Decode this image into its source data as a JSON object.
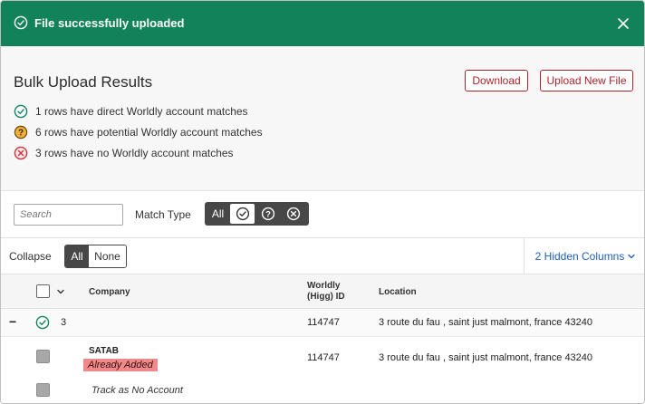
{
  "banner": {
    "message": "File successfully uploaded"
  },
  "results": {
    "title": "Bulk Upload Results",
    "download_label": "Download",
    "upload_label": "Upload New File",
    "summary": [
      {
        "text": "1 rows have direct Worldly account matches",
        "status": "direct"
      },
      {
        "text": "6 rows have potential Worldly account matches",
        "status": "potential"
      },
      {
        "text": "3 rows have no Worldly account matches",
        "status": "none"
      }
    ]
  },
  "filters": {
    "search_placeholder": "Search",
    "match_type_label": "Match Type",
    "match_options": [
      "All",
      "direct",
      "potential",
      "none"
    ],
    "selected": "direct"
  },
  "collapse": {
    "label": "Collapse",
    "options": [
      "All",
      "None"
    ],
    "selected": "All",
    "hidden_columns_label": "2 Hidden Columns"
  },
  "table": {
    "columns": {
      "company": "Company",
      "worldly_id_line1": "Worldly",
      "worldly_id_line2": "(Higg) ID",
      "location": "Location"
    },
    "group": {
      "toggle": "−",
      "count": "3",
      "worldly_id": "114747",
      "location": "3 route du fau , saint just malmont, france 43240"
    },
    "rows": [
      {
        "company": "SATAB",
        "badge": "Already Added",
        "worldly_id": "114747",
        "location": "3 route du fau , saint just malmont, france 43240"
      }
    ],
    "no_account_label": "Track as No Account"
  },
  "colors": {
    "banner": "#12825a",
    "accent_red": "#b0222b",
    "direct": "#12825a",
    "potential": "#f0b13c",
    "none": "#c8323c",
    "link": "#1f5fbf"
  }
}
